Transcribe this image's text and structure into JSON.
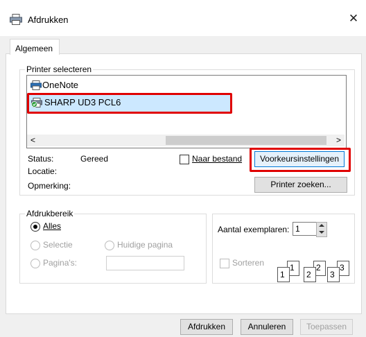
{
  "window": {
    "title": "Afdrukken",
    "close_glyph": "✕"
  },
  "tabs": [
    {
      "label": "Algemeen"
    }
  ],
  "printer_group": {
    "legend": "Printer selecteren",
    "printers": [
      {
        "name": "OneNote",
        "icon": "printer-icon"
      },
      {
        "name": "SHARP UD3 PCL6",
        "icon": "printer-default-icon"
      }
    ],
    "scroll_left": "<",
    "scroll_right": ">",
    "status_label": "Status:",
    "status_value": "Gereed",
    "location_label": "Locatie:",
    "comment_label": "Opmerking:",
    "print_to_file_label": "Naar bestand",
    "preferences_button": "Voorkeursinstellingen",
    "find_printer_button": "Printer zoeken..."
  },
  "range_group": {
    "legend": "Afdrukbereik",
    "all_label": "Alles",
    "selection_label": "Selectie",
    "current_page_label": "Huidige pagina",
    "pages_label": "Pagina's:",
    "pages_value": ""
  },
  "copies_group": {
    "copies_label": "Aantal exemplaren:",
    "copies_value": "1",
    "collate_label": "Sorteren",
    "collate_pages": [
      "1",
      "1",
      "2",
      "2",
      "3",
      "3"
    ]
  },
  "footer": {
    "print_button": "Afdrukken",
    "cancel_button": "Annuleren",
    "apply_button": "Toepassen"
  },
  "colors": {
    "highlight_border": "#e00000",
    "selection_bg": "#cce8ff",
    "disabled_text": "#a0a0a0"
  }
}
